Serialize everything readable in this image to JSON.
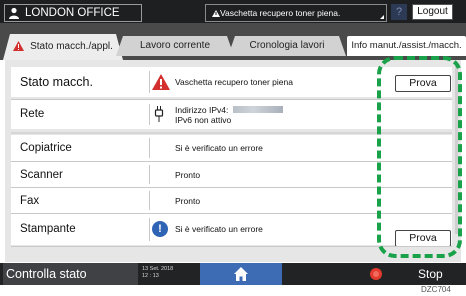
{
  "header": {
    "device_name": "LONDON OFFICE",
    "alert_text": "Vaschetta recupero toner piena.",
    "help_label": "?",
    "logout_label": "Logout"
  },
  "tabs": [
    {
      "label": "Stato macch./appl.",
      "active": true
    },
    {
      "label": "Lavoro corrente",
      "active": false
    },
    {
      "label": "Cronologia lavori",
      "active": false
    },
    {
      "label": "Info manut./assist./macch.",
      "active": false
    }
  ],
  "status_rows": {
    "machine": {
      "label": "Stato macch.",
      "value": "Vaschetta recupero toner piena",
      "button": "Prova"
    },
    "network": {
      "label": "Rete",
      "ipv4": "Indirizzo IPv4:",
      "ipv6": "IPv6 non attivo"
    },
    "copier": {
      "label": "Copiatrice",
      "value": "Si è verificato un errore"
    },
    "scanner": {
      "label": "Scanner",
      "value": "Pronto"
    },
    "fax": {
      "label": "Fax",
      "value": "Pronto"
    },
    "printer": {
      "label": "Stampante",
      "value": "Si è verificato un errore",
      "button": "Prova"
    }
  },
  "footer": {
    "status_check_label": "Controlla stato",
    "date": "13 Set. 2018",
    "time": "12 : 13",
    "stop_label": "Stop"
  },
  "figure_code": "DZC704",
  "colors": {
    "highlight_frame": "#1aa24b",
    "warning": "#d32f2f",
    "info": "#2f63b4",
    "home": "#3d6cb5",
    "stop": "#e23b2d"
  }
}
